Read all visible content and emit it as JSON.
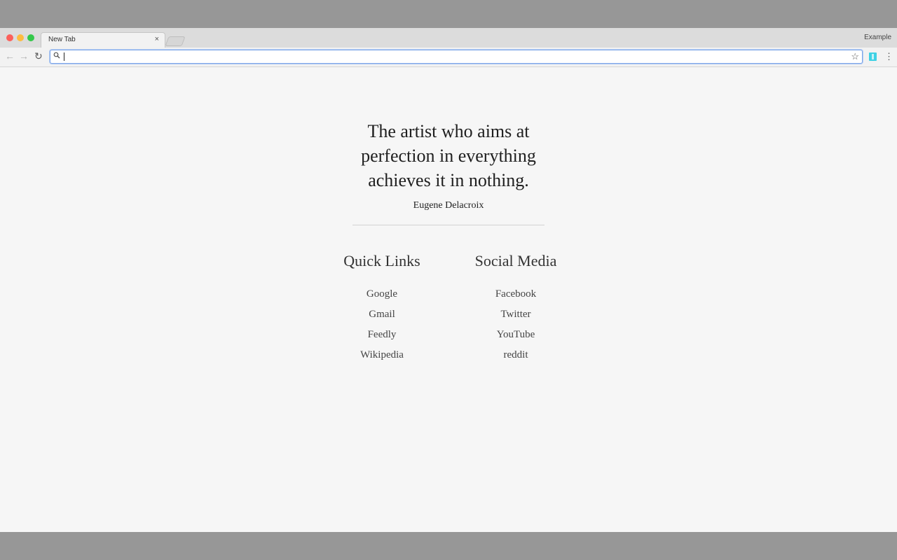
{
  "browser": {
    "tab_title": "New Tab",
    "tab_close": "×",
    "profile_label": "Example",
    "omnibox_value": "",
    "icons": {
      "back": "arrow-left-icon",
      "forward": "arrow-right-icon",
      "reload": "reload-icon",
      "search": "search-icon",
      "bookmark": "star-icon",
      "extension": "extension-icon",
      "menu": "more-vertical-icon"
    },
    "glyphs": {
      "back": "←",
      "forward": "→",
      "reload": "↻",
      "star": "☆",
      "menu": "⋮"
    }
  },
  "page": {
    "quote_lines": [
      "The artist who aims at",
      "perfection in everything",
      "achieves it in nothing."
    ],
    "author": "Eugene Delacroix",
    "quick_links": {
      "title": "Quick Links",
      "items": [
        "Google",
        "Gmail",
        "Feedly",
        "Wikipedia"
      ]
    },
    "social_media": {
      "title": "Social Media",
      "items": [
        "Facebook",
        "Twitter",
        "YouTube",
        "reddit"
      ]
    }
  }
}
